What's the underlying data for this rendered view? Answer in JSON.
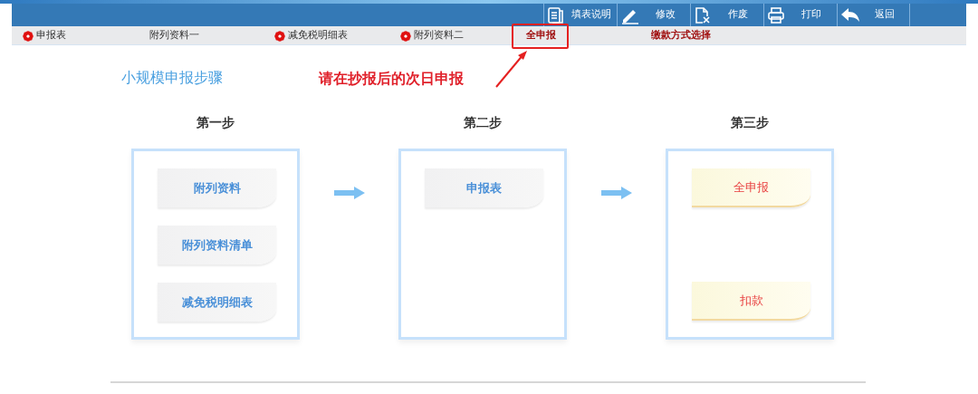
{
  "toolbar": [
    {
      "label": "填表说明"
    },
    {
      "label": "修改"
    },
    {
      "label": "作废"
    },
    {
      "label": "打印"
    },
    {
      "label": "返回"
    }
  ],
  "tabs": [
    {
      "label": "申报表",
      "flagged": true,
      "emphasized": false,
      "outlined": false
    },
    {
      "label": "附列资料一",
      "flagged": false,
      "emphasized": false,
      "outlined": false
    },
    {
      "label": "减免税明细表",
      "flagged": true,
      "emphasized": false,
      "outlined": false
    },
    {
      "label": "附列资料二",
      "flagged": true,
      "emphasized": false,
      "outlined": false
    },
    {
      "label": "全申报",
      "flagged": false,
      "emphasized": true,
      "outlined": true
    },
    {
      "label": "缴款方式选择",
      "flagged": false,
      "emphasized": true,
      "outlined": false
    }
  ],
  "heading": "小规模申报步骤",
  "note": "请在抄报后的次日申报",
  "steps": [
    {
      "title": "第一步",
      "items": [
        {
          "label": "附列资料",
          "kind": "form"
        },
        {
          "label": "附列资料清单",
          "kind": "form"
        },
        {
          "label": "减免税明细表",
          "kind": "form"
        }
      ]
    },
    {
      "title": "第二步",
      "items": [
        {
          "label": "申报表",
          "kind": "form"
        }
      ]
    },
    {
      "title": "第三步",
      "items": [
        {
          "label": "全申报",
          "kind": "action"
        },
        {
          "label": "扣款",
          "kind": "action"
        }
      ]
    }
  ]
}
